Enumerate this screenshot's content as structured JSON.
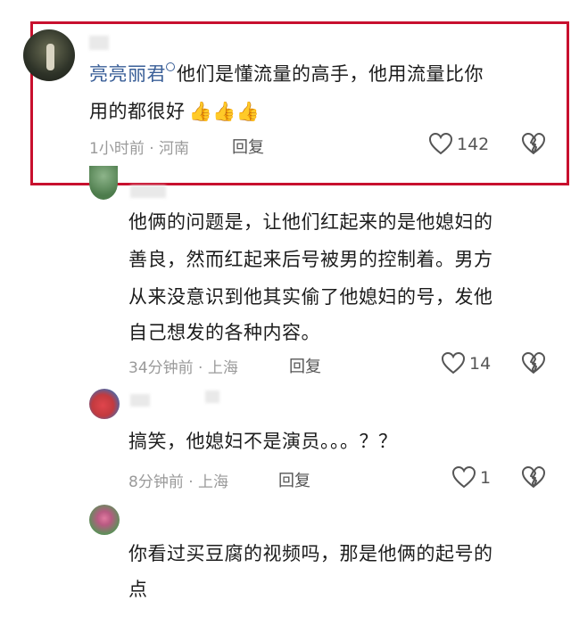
{
  "comments": [
    {
      "user": "亮亮丽君",
      "text_lines": [
        "他们是懂流量的高手，他用流量比你",
        "用的都很好"
      ],
      "emojis": "👍👍👍",
      "time": "1小时前",
      "location": "河南",
      "reply": "回复",
      "likes": "142"
    },
    {
      "text_lines": [
        "他俩的问题是，让他们红起来的是他媳妇的",
        "善良，然而红起来后号被男的控制着。男方",
        "从来没意识到他其实偷了他媳妇的号，发他",
        "自己想发的各种内容。"
      ],
      "time": "34分钟前",
      "location": "上海",
      "reply": "回复",
      "likes": "14"
    },
    {
      "text_lines": [
        "搞笑，他媳妇不是演员。。。？？"
      ],
      "time": "8分钟前",
      "location": "上海",
      "reply": "回复",
      "likes": "1"
    },
    {
      "text_lines": [
        "你看过买豆腐的视频吗，那是他俩的起号的",
        "点"
      ]
    }
  ],
  "separator": " · ",
  "colors": {
    "highlight": "#c8102e",
    "username": "#3a5f98",
    "meta": "#9a9a9a"
  },
  "icons": [
    "heart-icon",
    "broken-heart-icon"
  ]
}
